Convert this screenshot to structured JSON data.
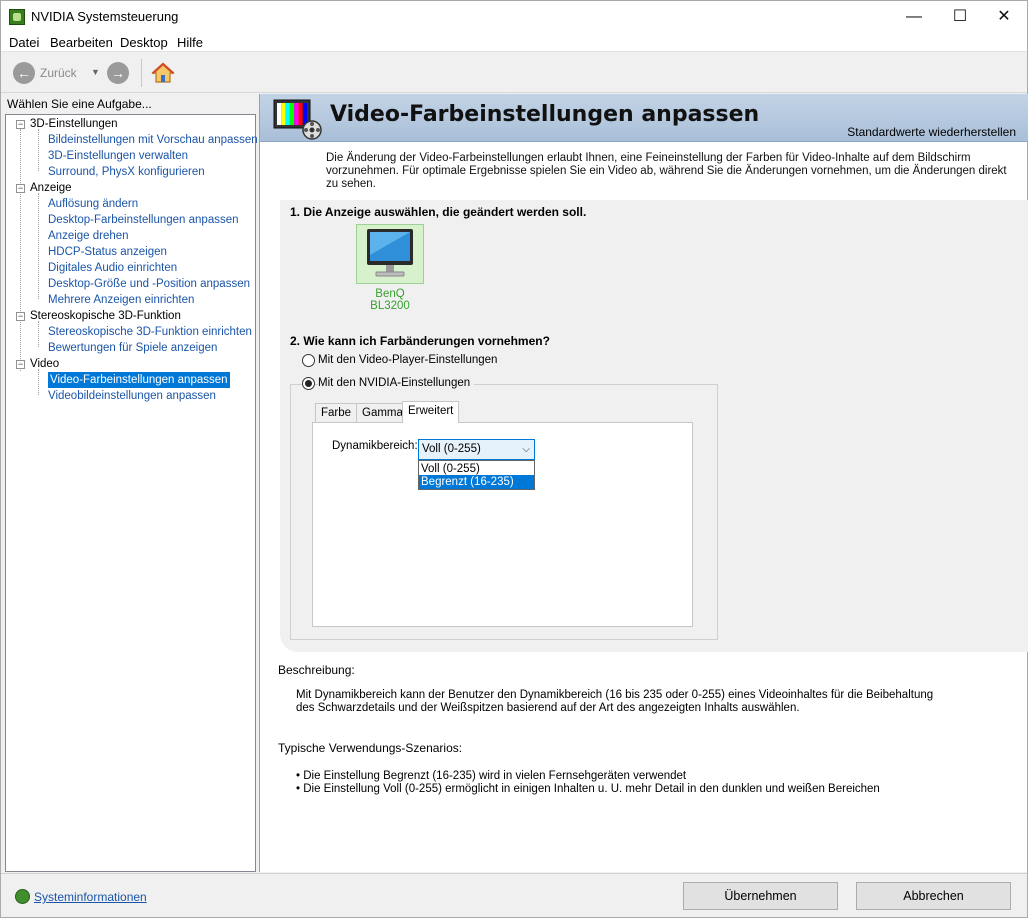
{
  "window": {
    "title": "NVIDIA Systemsteuerung",
    "minimize_glyph": "—",
    "maximize_glyph": "☐",
    "close_glyph": "✕"
  },
  "menu": [
    "Datei",
    "Bearbeiten",
    "Desktop",
    "Hilfe"
  ],
  "toolbar": {
    "back_label": "Zurück"
  },
  "sidebar": {
    "task_label": "Wählen Sie eine Aufgabe...",
    "categories": [
      {
        "label": "3D-Einstellungen",
        "items": [
          "Bildeinstellungen mit Vorschau anpassen",
          "3D-Einstellungen verwalten",
          "Surround, PhysX konfigurieren"
        ]
      },
      {
        "label": "Anzeige",
        "items": [
          "Auflösung ändern",
          "Desktop-Farbeinstellungen anpassen",
          "Anzeige drehen",
          "HDCP-Status anzeigen",
          "Digitales Audio einrichten",
          "Desktop-Größe und -Position anpassen",
          "Mehrere Anzeigen einrichten"
        ]
      },
      {
        "label": "Stereoskopische 3D-Funktion",
        "items": [
          "Stereoskopische 3D-Funktion einrichten",
          "Bewertungen für Spiele anzeigen"
        ]
      },
      {
        "label": "Video",
        "items": [
          "Video-Farbeinstellungen anpassen",
          "Videobildeinstellungen anpassen"
        ]
      }
    ],
    "selected_item": "Video-Farbeinstellungen anpassen"
  },
  "main": {
    "title": "Video-Farbeinstellungen anpassen",
    "restore_link": "Standardwerte wiederherstellen",
    "intro": "Die Änderung der Video-Farbeinstellungen erlaubt Ihnen, eine Feineinstellung der Farben für Video-Inhalte auf dem Bildschirm vorzunehmen. Für optimale Ergebnisse spielen Sie ein Video ab, während Sie die Änderungen vornehmen, um die Änderungen direkt zu sehen.",
    "step1": "1. Die Anzeige auswählen, die geändert werden soll.",
    "display_name": "BenQ BL3200",
    "step2": "2. Wie kann ich Farbänderungen vornehmen?",
    "radio_player": "Mit den Video-Player-Einstellungen",
    "radio_nvidia": "Mit den NVIDIA-Einstellungen",
    "selected_radio": "nvidia",
    "tabs": [
      "Farbe",
      "Gamma",
      "Erweitert"
    ],
    "active_tab": "Erweitert",
    "dynamic_range_label": "Dynamikbereich:",
    "dynamic_range_value": "Voll (0-255)",
    "dropdown_options": [
      "Voll (0-255)",
      "Begrenzt (16-235)"
    ],
    "highlighted_option": "Begrenzt (16-235)",
    "description_head": "Beschreibung:",
    "description_text": "Mit Dynamikbereich kann der Benutzer den Dynamikbereich (16 bis 235 oder 0-255) eines Videoinhaltes für die Beibehaltung des Schwarzdetails und der Weißspitzen basierend auf der Art des angezeigten Inhalts auswählen.",
    "scenarios_head": "Typische Verwendungs-Szenarios:",
    "scenarios": [
      "• Die Einstellung Begrenzt (16-235) wird in vielen Fernsehgeräten verwendet",
      "• Die Einstellung Voll (0-255) ermöglicht in einigen Inhalten u. U. mehr Detail in den dunklen und weißen Bereichen"
    ]
  },
  "footer": {
    "sysinfo": "Systeminformationen",
    "apply": "Übernehmen",
    "cancel": "Abbrechen"
  },
  "colors": {
    "accent": "#0078d7",
    "link": "#1a55a8",
    "nvidia_green": "#3aa12f",
    "banner": "#b4c8de"
  }
}
